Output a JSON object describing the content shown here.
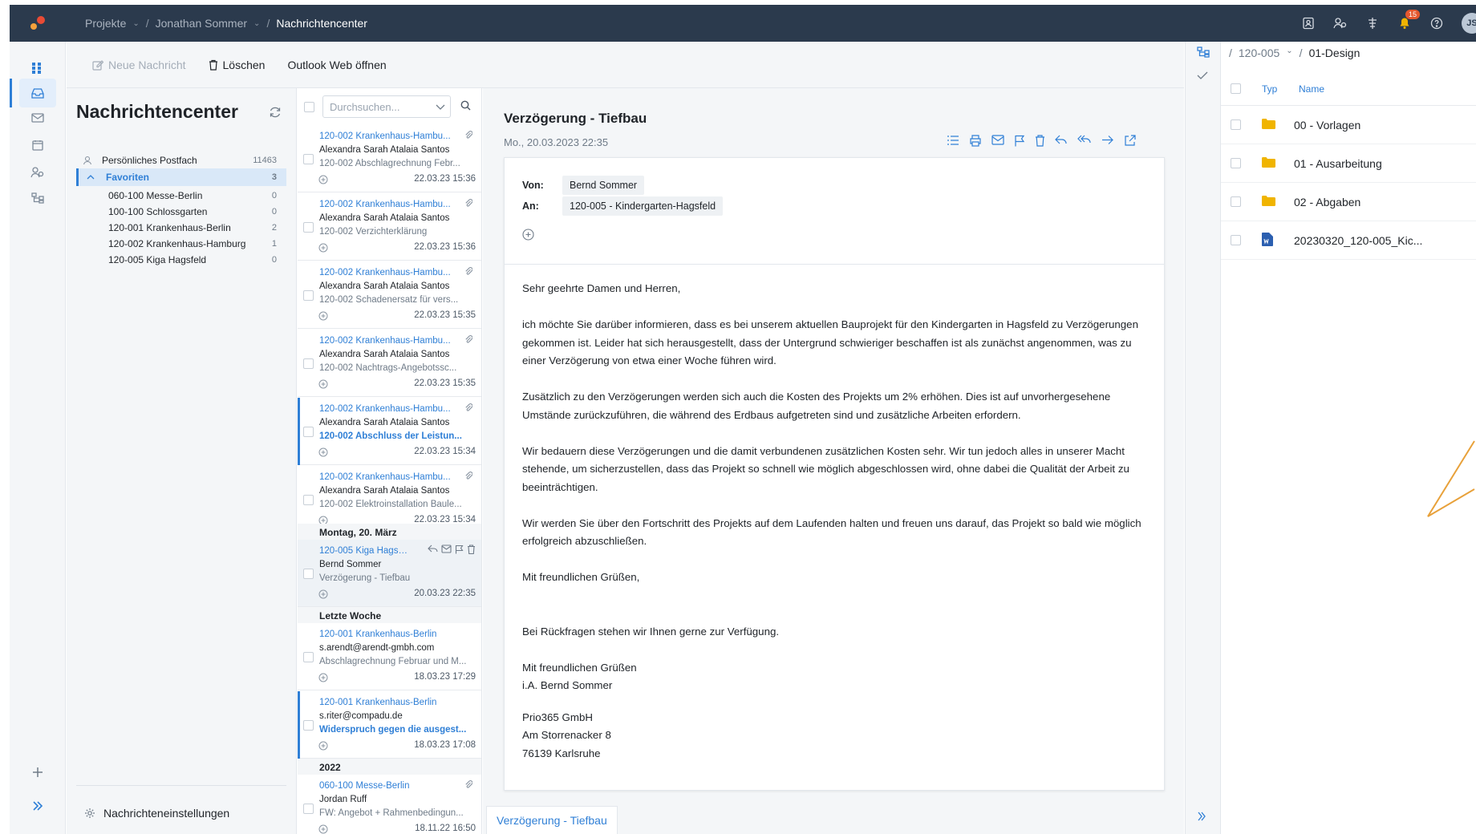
{
  "breadcrumb": {
    "project": "Projekte",
    "user": "Jonathan Sommer",
    "current": "Nachrichtencenter"
  },
  "topbar": {
    "notification_count": "15",
    "avatar_initials": "JS"
  },
  "toolbar": {
    "new_message": "Neue Nachricht",
    "delete": "Löschen",
    "outlook": "Outlook Web öffnen"
  },
  "folders": {
    "title": "Nachrichtencenter",
    "personal": {
      "label": "Persönliches Postfach",
      "count": "11463"
    },
    "favorites": {
      "label": "Favoriten",
      "count": "3"
    },
    "items": [
      {
        "label": "060-100 Messe-Berlin",
        "count": "0"
      },
      {
        "label": "100-100 Schlossgarten",
        "count": "0"
      },
      {
        "label": "120-001 Krankenhaus-Berlin",
        "count": "2"
      },
      {
        "label": "120-002 Krankenhaus-Hamburg",
        "count": "1"
      },
      {
        "label": "120-005 Kiga Hagsfeld",
        "count": "0"
      }
    ],
    "settings": "Nachrichteneinstellungen"
  },
  "messagelist": {
    "search_placeholder": "Durchsuchen...",
    "messages": [
      {
        "project": "120-002 Krankenhaus-Hambu...",
        "sender": "Alexandra Sarah Atalaia Santos",
        "subject": "120-002 Abschlagrechnung Febr...",
        "date": "22.03.23 15:36"
      },
      {
        "project": "120-002 Krankenhaus-Hambu...",
        "sender": "Alexandra Sarah Atalaia Santos",
        "subject": "120-002 Verzichterklärung",
        "date": "22.03.23 15:36"
      },
      {
        "project": "120-002 Krankenhaus-Hambu...",
        "sender": "Alexandra Sarah Atalaia Santos",
        "subject": "120-002 Schadenersatz für vers...",
        "date": "22.03.23 15:35"
      },
      {
        "project": "120-002 Krankenhaus-Hambu...",
        "sender": "Alexandra Sarah Atalaia Santos",
        "subject": "120-002 Nachtrags-Angebotssc...",
        "date": "22.03.23 15:35"
      },
      {
        "project": "120-002 Krankenhaus-Hambu...",
        "sender": "Alexandra Sarah Atalaia Santos",
        "subject": "120-002 Abschluss der Leistun...",
        "date": "22.03.23 15:34"
      },
      {
        "project": "120-002 Krankenhaus-Hambu...",
        "sender": "Alexandra Sarah Atalaia Santos",
        "subject": "120-002 Elektroinstallation Baule...",
        "date": "22.03.23 15:34"
      },
      {
        "project": "120-005 Kiga Hagsf...",
        "sender": "Bernd Sommer",
        "subject": "Verzögerung - Tiefbau",
        "date": "20.03.23 22:35"
      },
      {
        "project": "120-001 Krankenhaus-Berlin",
        "sender": "s.arendt@arendt-gmbh.com",
        "subject": "Abschlagrechnung Februar und M...",
        "date": "18.03.23 17:29"
      },
      {
        "project": "120-001 Krankenhaus-Berlin",
        "sender": "s.riter@compadu.de",
        "subject": "Widerspruch gegen die ausgest...",
        "date": "18.03.23 17:08"
      },
      {
        "project": "060-100 Messe-Berlin",
        "sender": "Jordan Ruff",
        "subject": "FW: Angebot + Rahmenbedingun...",
        "date": "18.11.22 16:50"
      }
    ],
    "groups": [
      "Montag, 20. März",
      "Letzte Woche",
      "2022"
    ]
  },
  "reader": {
    "subject": "Verzögerung - Tiefbau",
    "datetime": "Mo., 20.03.2023 22:35",
    "from_label": "Von:",
    "from": "Bernd Sommer",
    "to_label": "An:",
    "to": "120-005 - Kindergarten-Hagsfeld",
    "body": {
      "p1": "Sehr geehrte Damen und Herren,",
      "p2": "ich möchte Sie darüber informieren, dass es bei unserem aktuellen Bauprojekt für den Kindergarten in Hagsfeld zu Verzögerungen gekommen ist. Leider hat sich herausgestellt, dass der Untergrund schwieriger beschaffen ist als zunächst angenommen, was zu einer Verzögerung von etwa einer Woche führen wird.",
      "p3": "Zusätzlich zu den Verzögerungen werden sich auch die Kosten des Projekts um 2% erhöhen. Dies ist auf unvorhergesehene Umstände zurückzuführen, die während des Erdbaus aufgetreten sind und zusätzliche Arbeiten erfordern.",
      "p4": "Wir bedauern diese Verzögerungen und die damit verbundenen zusätzlichen Kosten sehr. Wir tun jedoch alles in unserer Macht stehende, um sicherzustellen, dass das Projekt so schnell wie möglich abgeschlossen wird, ohne dabei die Qualität der Arbeit zu beeinträchtigen.",
      "p5": "Wir werden Sie über den Fortschritt des Projekts auf dem Laufenden halten und freuen uns darauf, das Projekt so bald wie möglich erfolgreich abzuschließen.",
      "p6": "Mit freundlichen Grüßen,",
      "p7": "Bei Rückfragen stehen wir Ihnen gerne zur Verfügung.",
      "p8a": "Mit freundlichen Grüßen",
      "p8b": "i.A. Bernd Sommer",
      "p9a": "Prio365 GmbH",
      "p9b": "Am Storrenacker 8",
      "p9c": "76139 Karlsruhe"
    },
    "tab": "Verzögerung - Tiefbau"
  },
  "files": {
    "crumb_project": "120-005",
    "crumb_folder": "01-Design",
    "col_type": "Typ",
    "col_name": "Name",
    "rows": [
      {
        "name": "00 - Vorlagen",
        "kind": "folder"
      },
      {
        "name": "01 - Ausarbeitung",
        "kind": "folder"
      },
      {
        "name": "02 - Abgaben",
        "kind": "folder"
      },
      {
        "name": "20230320_120-005_Kic...",
        "kind": "word-doc"
      }
    ]
  },
  "colors": {
    "topbar": "#2b3a4d",
    "accent": "#2f7fd6",
    "folder": "#f0b400",
    "annotation_arrow": "#e8a13a"
  }
}
